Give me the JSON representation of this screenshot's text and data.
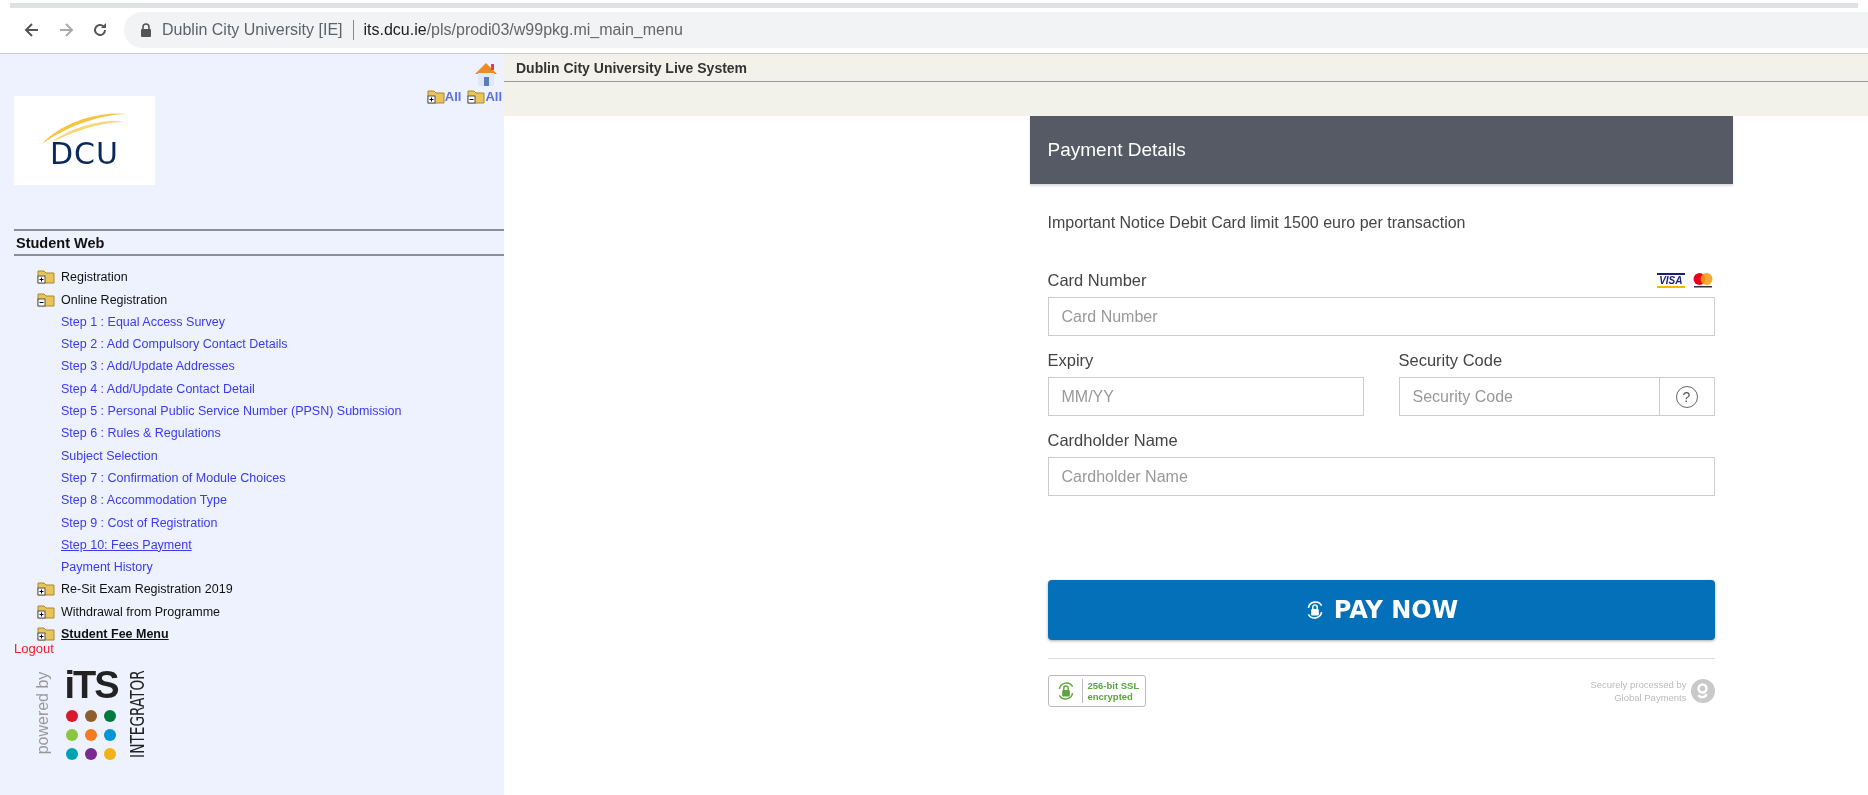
{
  "browser": {
    "site_name": "Dublin City University [IE]",
    "url_domain": "its.dcu.ie",
    "url_path": "/pls/prodi03/w99pkg.mi_main_menu"
  },
  "sidebar": {
    "expand_all": "All",
    "collapse_all": "All",
    "logo_text": "DCU",
    "section_title": "Student Web",
    "menu": [
      {
        "label": "Registration",
        "expanded": false,
        "emphasized": false
      },
      {
        "label": "Online Registration",
        "expanded": true,
        "emphasized": false,
        "children": [
          {
            "label": "Step 1 : Equal Access Survey",
            "underlined": false
          },
          {
            "label": "Step 2 : Add Compulsory Contact Details",
            "underlined": false
          },
          {
            "label": "Step 3 : Add/Update Addresses",
            "underlined": false
          },
          {
            "label": "Step 4 : Add/Update Contact Detail",
            "underlined": false
          },
          {
            "label": "Step 5 : Personal Public Service Number (PPSN) Submission",
            "underlined": false
          },
          {
            "label": "Step 6 : Rules & Regulations",
            "underlined": false
          },
          {
            "label": "Subject Selection",
            "underlined": false
          },
          {
            "label": "Step 7 : Confirmation of Module Choices",
            "underlined": false
          },
          {
            "label": "Step 8 : Accommodation Type",
            "underlined": false
          },
          {
            "label": "Step 9 : Cost of Registration",
            "underlined": false
          },
          {
            "label": "Step 10: Fees Payment",
            "underlined": true
          },
          {
            "label": "Payment History",
            "underlined": false
          }
        ]
      },
      {
        "label": "Re-Sit Exam Registration 2019",
        "expanded": false,
        "emphasized": false
      },
      {
        "label": "Withdrawal from Programme",
        "expanded": false,
        "emphasized": false
      },
      {
        "label": "Student Fee Menu",
        "expanded": false,
        "emphasized": true
      }
    ],
    "logout": "Logout",
    "powered_by": "powered by",
    "its_wordmark": "iTS",
    "its_subtitle": "INTEGRATOR"
  },
  "header": {
    "title": "Dublin City University Live System"
  },
  "payment": {
    "title": "Payment Details",
    "notice": "Important Notice Debit Card limit 1500 euro per transaction",
    "rows": [
      {
        "fields": [
          {
            "kind": "card",
            "label": "Card Number",
            "placeholder": "Card Number",
            "visa_mark": "VISA"
          }
        ]
      },
      {
        "fields": [
          {
            "kind": "plain",
            "label": "Expiry",
            "placeholder": "MM/YY"
          },
          {
            "kind": "help",
            "label": "Security Code",
            "placeholder": "Security Code",
            "help": "?"
          }
        ]
      },
      {
        "fields": [
          {
            "kind": "plain",
            "label": "Cardholder Name",
            "placeholder": "Cardholder Name"
          }
        ]
      }
    ],
    "pay_button": "PAY NOW",
    "ssl_badge": [
      "256-bit SSL",
      "encrypted"
    ],
    "processed_by": [
      "Securely processed by",
      "Global Payments"
    ]
  }
}
